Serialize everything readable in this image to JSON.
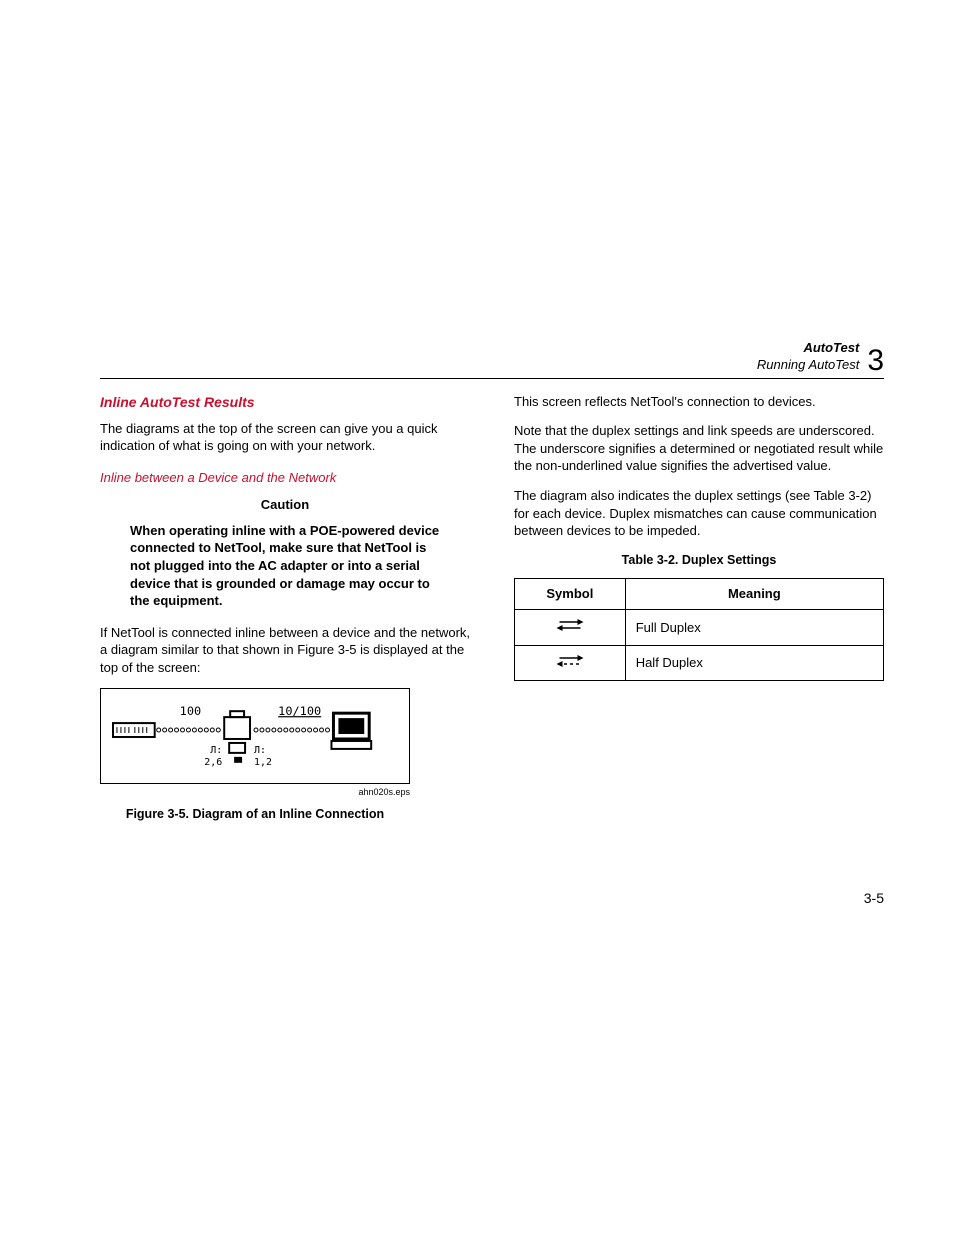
{
  "header": {
    "chapterTitle": "AutoTest",
    "chapterSubtitle": "Running AutoTest",
    "chapterNumber": "3"
  },
  "left": {
    "h1": "Inline AutoTest Results",
    "p1": "The diagrams at the top of the screen can give you a quick indication of what is going on with your network.",
    "h2": "Inline between a Device and the Network",
    "cautionLabel": "Caution",
    "cautionBody": "When operating inline with a POE-powered device connected to NetTool, make sure that NetTool is not plugged into the AC adapter or into a serial device that is grounded or damage may occur to the equipment.",
    "p2": "If NetTool is connected inline between a device and the network, a diagram similar to that shown in Figure 3-5 is displayed at the top of the screen:",
    "figure": {
      "leftSpeed": "100",
      "rightSpeed": "10/100",
      "eps": "ahn020s.eps",
      "caption": "Figure 3-5. Diagram of an Inline Connection"
    }
  },
  "right": {
    "p1": "This screen reflects NetTool's connection to devices.",
    "p2": "Note that the duplex settings and link speeds are underscored. The underscore signifies a determined or negotiated result while the non-underlined value signifies the advertised value.",
    "p3": "The diagram also indicates the duplex settings (see Table 3-2) for each device. Duplex mismatches can cause communication between devices to be impeded.",
    "tableCaption": "Table 3-2. Duplex Settings",
    "table": {
      "hSymbol": "Symbol",
      "hMeaning": "Meaning",
      "row1Meaning": "Full Duplex",
      "row2Meaning": "Half Duplex"
    }
  },
  "pageNumber": "3-5"
}
